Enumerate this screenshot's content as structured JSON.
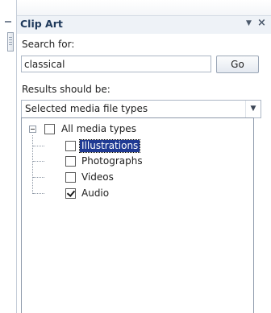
{
  "pane": {
    "title": "Clip Art",
    "menu_glyph": "▼",
    "close_glyph": "×"
  },
  "search": {
    "label": "Search for:",
    "value": "classical",
    "go_label": "Go"
  },
  "results": {
    "label": "Results should be:",
    "selected_value": "Selected media file types",
    "arrow_glyph": "▼"
  },
  "tree": {
    "root": {
      "label": "All media types",
      "checked": false,
      "expanded": true
    },
    "items": [
      {
        "label": "Illustrations",
        "checked": false,
        "selected": true
      },
      {
        "label": "Photographs",
        "checked": false,
        "selected": false
      },
      {
        "label": "Videos",
        "checked": false,
        "selected": false
      },
      {
        "label": "Audio",
        "checked": true,
        "selected": false
      }
    ]
  },
  "colors": {
    "title_text": "#1e395b",
    "selection_bg": "#1f3a93"
  }
}
